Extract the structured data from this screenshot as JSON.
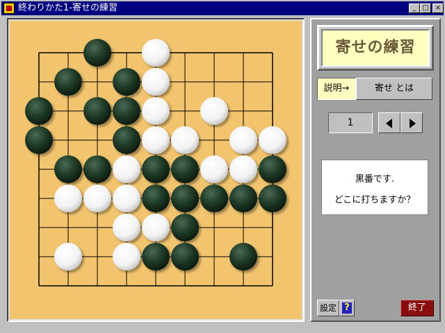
{
  "window": {
    "title": "終わりかた1-寄せの練習",
    "controls": {
      "minimize": "_",
      "maximize": "□",
      "close": "×"
    }
  },
  "board": {
    "size": 9,
    "colors": {
      "wood": "#f2c46e",
      "line": "#000000",
      "black_stone": "#1e3a26",
      "white_stone": "#ffffff"
    },
    "rows": [
      "..B.W....",
      ".B.BW....",
      "B.BBW.W..",
      "B..BWW.WW",
      ".BBWBBWWB",
      ".WWWBBBBB",
      "...WWB...",
      ".W.WBB.B.",
      "........."
    ]
  },
  "panel": {
    "title": "寄せの練習",
    "explain_button": "説明→",
    "about_button": "寄せ とは",
    "problem_number": "1",
    "message_line1": "黒番です.",
    "message_line2": "どこに打ちますか？",
    "settings_button": "設定",
    "help_icon": "?",
    "quit_button": "終了"
  }
}
